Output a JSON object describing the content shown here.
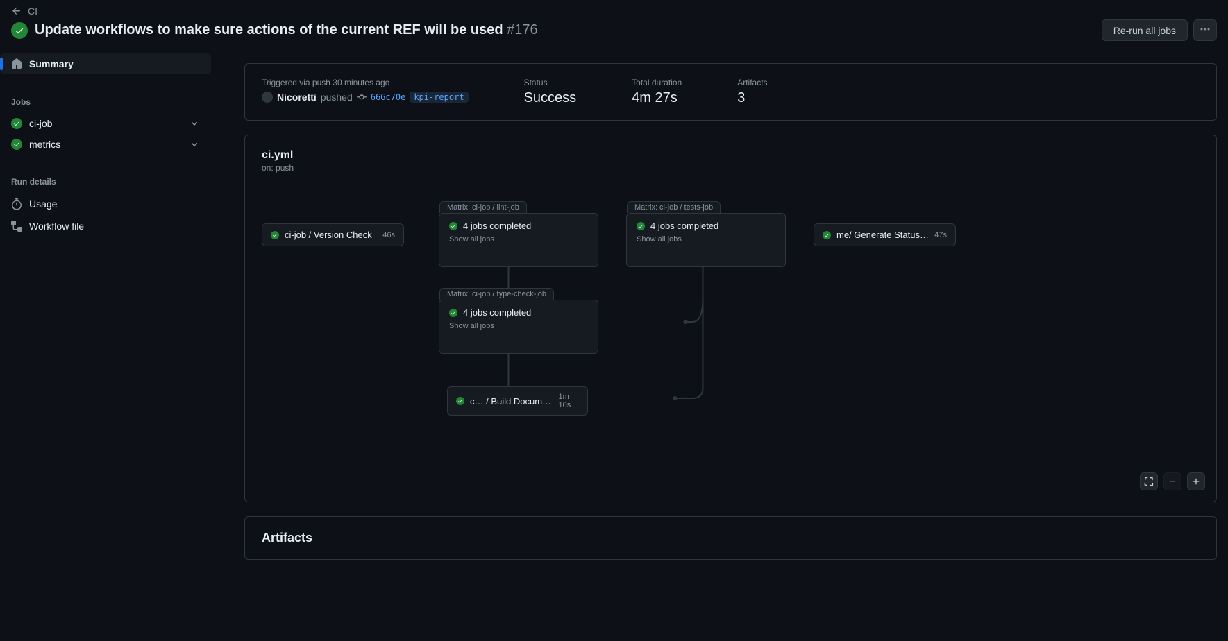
{
  "breadcrumb": {
    "label": "CI"
  },
  "header": {
    "title": "Update workflows to make sure actions of the current REF will be used",
    "run_number": "#176",
    "rerun_label": "Re-run all jobs"
  },
  "sidebar": {
    "summary": "Summary",
    "jobs_label": "Jobs",
    "jobs": [
      {
        "name": "ci-job"
      },
      {
        "name": "metrics"
      }
    ],
    "details_label": "Run details",
    "usage": "Usage",
    "workflow_file": "Workflow file"
  },
  "summary": {
    "triggered": "Triggered via push 30 minutes ago",
    "actor": "Nicoretti",
    "action": "pushed",
    "sha": "666c70e",
    "branch": "kpi-report",
    "status_label": "Status",
    "status_value": "Success",
    "duration_label": "Total duration",
    "duration_value": "4m 27s",
    "artifacts_label": "Artifacts",
    "artifacts_value": "3"
  },
  "graph": {
    "workflow_name": "ci.yml",
    "trigger": "on: push",
    "nodes": {
      "version_check": {
        "name": "ci-job / Version Check",
        "time": "46s"
      },
      "lint": {
        "label": "Matrix: ci-job / lint-job",
        "completed": "4 jobs completed",
        "show_all": "Show all jobs"
      },
      "type_check": {
        "label": "Matrix: ci-job / type-check-job",
        "completed": "4 jobs completed",
        "show_all": "Show all jobs"
      },
      "build_docs": {
        "name": "c… / Build Documentat…",
        "time": "1m 10s"
      },
      "tests": {
        "label": "Matrix: ci-job / tests-job",
        "completed": "4 jobs completed",
        "show_all": "Show all jobs"
      },
      "status_report": {
        "name": "me/ Generate Status Report",
        "time": "47s"
      }
    }
  },
  "artifacts": {
    "title": "Artifacts"
  }
}
